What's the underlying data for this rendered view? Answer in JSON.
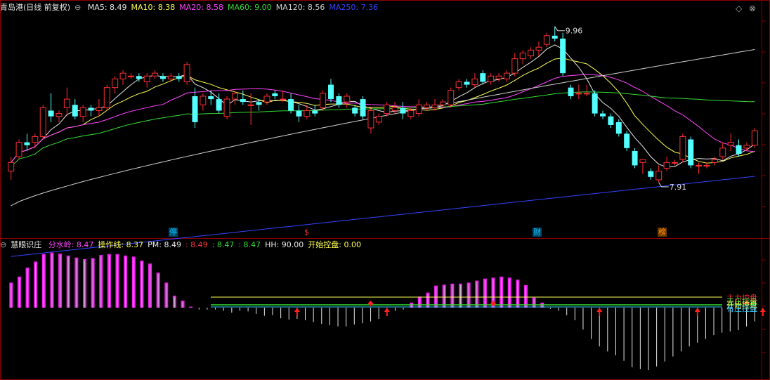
{
  "header_main": {
    "title": "青岛港(日线 前复权)",
    "indicators": [
      {
        "label": "MA5: 8.49",
        "color": "#e8e8e8"
      },
      {
        "label": "MA10: 8.38",
        "color": "#ffff55"
      },
      {
        "label": "MA20: 8.58",
        "color": "#ff44ff"
      },
      {
        "label": "MA60: 9.00",
        "color": "#33dd33"
      },
      {
        "label": "MA120: 8.56",
        "color": "#d0d0d0"
      },
      {
        "label": "MA250: 7.36",
        "color": "#3344ff"
      }
    ]
  },
  "header_sub": {
    "title": "慧眼识庄",
    "indicators": [
      {
        "label": "分水岭: 8.47",
        "color": "#ff44ff"
      },
      {
        "label": "操作线: 8.37",
        "color": "#ffff55"
      },
      {
        "label": "PM: 8.49",
        "color": "#e8e8e8"
      },
      {
        "label": ": 8.49",
        "color": "#ff3333"
      },
      {
        "label": ": 8.47",
        "color": "#33dd33"
      },
      {
        "label": ": 8.47",
        "color": "#33dd33"
      },
      {
        "label": "HH: 90.00",
        "color": "#e8e8e8"
      },
      {
        "label": "开始控盘: 0.00",
        "color": "#ffff55"
      }
    ]
  },
  "event_tags": [
    {
      "text": "停",
      "color": "#00c8ff",
      "bg": "#004466"
    },
    {
      "text": "$",
      "color": "#ff3333",
      "bg": "transparent"
    },
    {
      "text": "财",
      "color": "#00c8ff",
      "bg": "#004466"
    },
    {
      "text": "榜",
      "color": "#ff9900",
      "bg": "#663300"
    }
  ],
  "legend_labels": [
    {
      "text": "主力控盘",
      "color": "#ff3333"
    },
    {
      "text": "无庄控盘",
      "color": "#33dd33"
    },
    {
      "text": "开始控盘",
      "color": "#ffff55"
    },
    {
      "text": "有庄控盘",
      "color": "#33ccff"
    }
  ],
  "chart_data": [
    {
      "type": "candlestick",
      "title": "青岛港(日线 前复权)",
      "ylim": [
        6.3,
        10.2
      ],
      "annotations": {
        "high": "9.96",
        "low": "7.91"
      },
      "candles": [
        [
          7.45,
          7.6,
          7.3,
          7.7
        ],
        [
          7.7,
          7.95,
          7.65,
          8.0
        ],
        [
          7.95,
          7.9,
          7.8,
          8.1
        ],
        [
          7.95,
          8.05,
          7.85,
          8.1
        ],
        [
          8.05,
          8.55,
          8.0,
          8.6
        ],
        [
          8.5,
          8.4,
          8.3,
          8.8
        ],
        [
          8.4,
          8.45,
          8.3,
          8.5
        ],
        [
          8.55,
          8.7,
          8.4,
          8.9
        ],
        [
          8.6,
          8.4,
          8.35,
          8.7
        ],
        [
          8.4,
          8.55,
          8.3,
          8.6
        ],
        [
          8.55,
          8.5,
          8.4,
          8.6
        ],
        [
          8.5,
          8.55,
          8.4,
          8.7
        ],
        [
          8.55,
          8.9,
          8.5,
          8.95
        ],
        [
          8.9,
          9.05,
          8.8,
          9.1
        ],
        [
          9.05,
          9.15,
          8.95,
          9.2
        ],
        [
          9.1,
          9.1,
          9.05,
          9.15
        ],
        [
          9.1,
          9.05,
          9.0,
          9.15
        ],
        [
          9.0,
          9.1,
          8.9,
          9.15
        ],
        [
          9.1,
          9.15,
          9.05,
          9.2
        ],
        [
          9.1,
          9.05,
          9.0,
          9.15
        ],
        [
          9.05,
          9.1,
          9.0,
          9.15
        ],
        [
          9.1,
          9.05,
          9.0,
          9.15
        ],
        [
          9.0,
          9.3,
          8.95,
          9.35
        ],
        [
          8.75,
          8.3,
          8.2,
          8.9
        ],
        [
          8.6,
          8.75,
          8.5,
          8.8
        ],
        [
          8.75,
          8.7,
          8.6,
          8.85
        ],
        [
          8.7,
          8.5,
          8.45,
          8.8
        ],
        [
          8.4,
          8.7,
          8.35,
          8.75
        ],
        [
          8.7,
          8.8,
          8.6,
          8.85
        ],
        [
          8.7,
          8.65,
          8.6,
          8.85
        ],
        [
          8.6,
          8.6,
          8.25,
          8.8
        ],
        [
          8.65,
          8.6,
          8.5,
          8.7
        ],
        [
          8.65,
          8.75,
          8.6,
          8.8
        ],
        [
          8.8,
          8.75,
          8.7,
          8.85
        ],
        [
          8.7,
          8.7,
          8.65,
          8.85
        ],
        [
          8.7,
          8.5,
          8.45,
          8.8
        ],
        [
          8.5,
          8.4,
          8.3,
          8.6
        ],
        [
          8.4,
          8.5,
          8.35,
          8.6
        ],
        [
          8.5,
          8.45,
          8.4,
          8.6
        ],
        [
          8.55,
          8.8,
          8.5,
          8.85
        ],
        [
          8.95,
          8.7,
          8.65,
          9.05
        ],
        [
          8.75,
          8.6,
          8.55,
          8.8
        ],
        [
          8.65,
          8.75,
          8.55,
          8.8
        ],
        [
          8.55,
          8.45,
          8.4,
          8.6
        ],
        [
          8.7,
          8.4,
          8.35,
          8.75
        ],
        [
          8.2,
          8.5,
          8.1,
          8.55
        ],
        [
          8.3,
          8.4,
          8.25,
          8.45
        ],
        [
          8.45,
          8.6,
          8.4,
          8.65
        ],
        [
          8.5,
          8.55,
          8.45,
          8.65
        ],
        [
          8.55,
          8.45,
          8.35,
          8.65
        ],
        [
          8.4,
          8.5,
          8.35,
          8.55
        ],
        [
          8.45,
          8.6,
          8.4,
          8.7
        ],
        [
          8.55,
          8.6,
          8.5,
          8.65
        ],
        [
          8.55,
          8.6,
          8.5,
          8.7
        ],
        [
          8.6,
          8.65,
          8.55,
          8.7
        ],
        [
          8.6,
          8.85,
          8.55,
          8.9
        ],
        [
          8.9,
          9.0,
          8.85,
          9.05
        ],
        [
          9.0,
          8.95,
          8.9,
          9.05
        ],
        [
          8.95,
          9.05,
          8.9,
          9.15
        ],
        [
          9.15,
          9.0,
          8.95,
          9.2
        ],
        [
          9.0,
          9.1,
          8.95,
          9.15
        ],
        [
          9.05,
          9.1,
          9.0,
          9.15
        ],
        [
          9.05,
          9.15,
          9.0,
          9.2
        ],
        [
          9.15,
          9.4,
          9.1,
          9.5
        ],
        [
          9.4,
          9.5,
          9.3,
          9.55
        ],
        [
          9.45,
          9.55,
          9.4,
          9.6
        ],
        [
          9.55,
          9.6,
          9.45,
          9.7
        ],
        [
          9.65,
          9.8,
          9.6,
          9.85
        ],
        [
          9.8,
          9.75,
          9.7,
          9.96
        ],
        [
          9.75,
          9.15,
          9.1,
          9.85
        ],
        [
          8.9,
          8.75,
          8.7,
          8.95
        ],
        [
          8.8,
          8.8,
          8.7,
          8.95
        ],
        [
          8.8,
          8.8,
          8.75,
          8.95
        ],
        [
          8.8,
          8.45,
          8.4,
          8.85
        ],
        [
          8.45,
          8.4,
          8.35,
          8.5
        ],
        [
          8.4,
          8.25,
          8.2,
          8.45
        ],
        [
          8.3,
          8.1,
          8.05,
          8.35
        ],
        [
          8.1,
          7.85,
          7.8,
          8.15
        ],
        [
          7.8,
          7.55,
          7.5,
          7.85
        ],
        [
          7.6,
          7.65,
          7.4,
          7.65
        ],
        [
          7.45,
          7.35,
          7.3,
          7.5
        ],
        [
          7.3,
          7.45,
          7.25,
          7.55
        ],
        [
          7.5,
          7.6,
          7.45,
          7.7
        ],
        [
          7.6,
          7.6,
          7.55,
          7.65
        ],
        [
          7.65,
          8.05,
          7.6,
          8.1
        ],
        [
          8.0,
          7.55,
          7.5,
          8.05
        ],
        [
          7.55,
          7.55,
          7.4,
          7.6
        ],
        [
          7.55,
          7.55,
          7.5,
          7.6
        ],
        [
          7.6,
          7.65,
          7.55,
          7.7
        ],
        [
          7.7,
          7.85,
          7.65,
          7.95
        ],
        [
          7.9,
          7.95,
          7.8,
          8.1
        ],
        [
          7.9,
          7.75,
          7.7,
          8.0
        ],
        [
          7.85,
          7.9,
          7.8,
          7.95
        ],
        [
          7.9,
          8.15,
          7.85,
          8.2
        ]
      ],
      "candle_fields": [
        "open",
        "close",
        "low",
        "high"
      ],
      "series": [
        {
          "name": "MA5",
          "color": "#e8e8e8"
        },
        {
          "name": "MA10",
          "color": "#ffff55"
        },
        {
          "name": "MA20",
          "color": "#ff44ff"
        },
        {
          "name": "MA60",
          "color": "#33dd33"
        },
        {
          "name": "MA120",
          "color": "#d0d0d0"
        },
        {
          "name": "MA250",
          "color": "#3344ff"
        }
      ],
      "ma120_values": [
        6.85,
        9.56
      ],
      "ma250_values": [
        5.97,
        7.36
      ]
    },
    {
      "type": "bar",
      "title": "慧眼识庄",
      "bars": [
        50,
        62,
        80,
        92,
        107,
        110,
        108,
        104,
        100,
        97,
        99,
        105,
        107,
        107,
        104,
        102,
        94,
        88,
        70,
        50,
        24,
        14,
        2,
        -3,
        -3,
        -3,
        -5,
        -8,
        -5,
        -6,
        -10,
        -13,
        -12,
        -17,
        -19,
        -18,
        -20,
        -23,
        -26,
        -28,
        -30,
        -30,
        -27,
        -25,
        -22,
        -18,
        -10,
        -5,
        -3,
        10,
        22,
        30,
        44,
        46,
        48,
        48,
        50,
        54,
        58,
        60,
        62,
        60,
        56,
        45,
        20,
        10,
        -2,
        -5,
        -12,
        -20,
        -35,
        -50,
        -62,
        -70,
        -76,
        -85,
        -95,
        -98,
        -100,
        -94,
        -86,
        -78,
        -70,
        -62,
        -56,
        -50,
        -44,
        -40,
        -38,
        -36,
        -30,
        -22
      ],
      "ylim": [
        -110,
        115
      ],
      "markers": {
        "up_arrows": [
          35,
          46,
          72,
          84,
          92
        ],
        "diamonds": [
          44,
          59,
          90
        ]
      }
    }
  ]
}
